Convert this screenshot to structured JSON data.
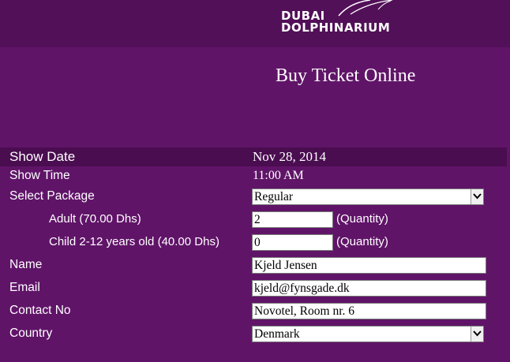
{
  "brand": {
    "line1": "DUBAI",
    "line2": "DOLPHINARIUM"
  },
  "page_title": "Buy Ticket Online",
  "form": {
    "show_date": {
      "label": "Show Date",
      "value": "Nov 28, 2014"
    },
    "show_time": {
      "label": "Show Time",
      "value": "11:00 AM"
    },
    "package": {
      "label": "Select Package",
      "value": "Regular"
    },
    "adult": {
      "label": "Adult (70.00 Dhs)",
      "value": "2",
      "note": "(Quantity)"
    },
    "child": {
      "label": "Child 2-12 years old (40.00 Dhs)",
      "value": "0",
      "note": "(Quantity)"
    },
    "name": {
      "label": "Name",
      "value": "Kjeld Jensen"
    },
    "email": {
      "label": "Email",
      "value": "kjeld@fynsgade.dk"
    },
    "contact": {
      "label": "Contact No",
      "value": "Novotel, Room nr. 6"
    },
    "country": {
      "label": "Country",
      "value": "Denmark"
    }
  },
  "colors": {
    "background": "#601468",
    "header": "#521058",
    "date_band": "#4a0d50"
  },
  "icons": {
    "dropdown": "chevron-down-icon"
  }
}
